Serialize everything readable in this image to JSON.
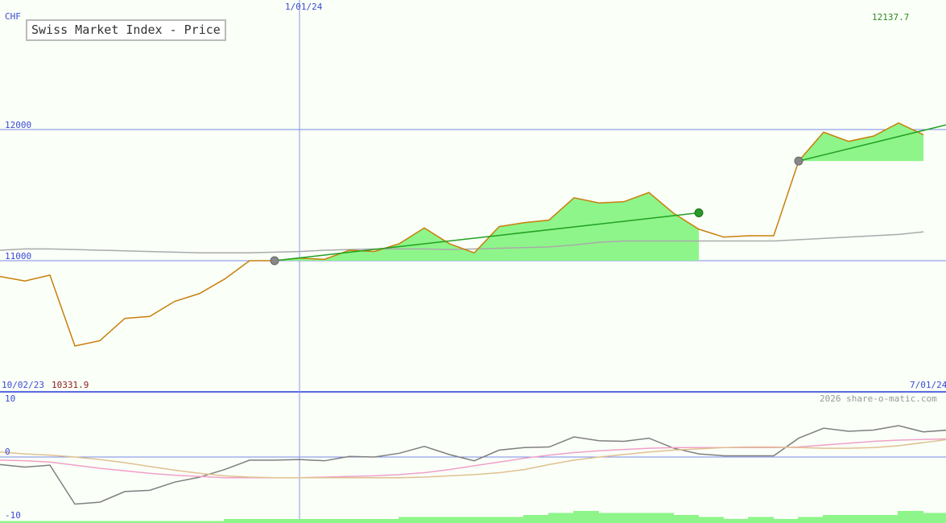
{
  "chart_data": [
    {
      "type": "line",
      "title": "Swiss Market Index - Price",
      "currency": "CHF",
      "ylim": [
        10270,
        12270
      ],
      "ytick_labels": [
        "12000",
        "11000"
      ],
      "ytick_values": [
        12000,
        11000
      ],
      "vline_label": "1/01/24",
      "vline_x": 12,
      "x_start_label": "10/02/23",
      "x_end_label": "7/01/24",
      "low_label": "10331.9",
      "high_label": "12137.7",
      "x_count": 38,
      "series": [
        {
          "name": "",
          "color": "#c87f0a",
          "values": [
            10880,
            10845,
            10890,
            10350,
            10390,
            10560,
            10575,
            10690,
            10750,
            10860,
            11000,
            11000,
            11020,
            11010,
            11080,
            11070,
            11130,
            11250,
            11130,
            11060,
            11260,
            11290,
            11310,
            11480,
            11440,
            11450,
            11520,
            11360,
            11240,
            11180,
            11190,
            11190,
            11760,
            11980,
            11910,
            11950,
            12050,
            11960
          ]
        },
        {
          "name": "",
          "color": "#aaaaaa",
          "values": [
            11080,
            11090,
            11090,
            11085,
            11080,
            11075,
            11070,
            11065,
            11060,
            11060,
            11060,
            11065,
            11070,
            11080,
            11085,
            11090,
            11090,
            11090,
            11085,
            11090,
            11095,
            11100,
            11105,
            11120,
            11140,
            11150,
            11150,
            11150,
            11150,
            11150,
            11150,
            11150,
            11160,
            11170,
            11180,
            11190,
            11200,
            11220
          ]
        }
      ],
      "trend_segments": [
        {
          "from": [
            11,
            11000
          ],
          "to": [
            28,
            11365
          ]
        },
        {
          "from": [
            32,
            11760
          ],
          "to": [
            38,
            12040
          ]
        }
      ]
    },
    {
      "type": "line",
      "title": "",
      "ylim": [
        -10,
        10
      ],
      "ytick_labels": [
        "10",
        "0",
        "-10"
      ],
      "ytick_values": [
        10,
        0,
        -10
      ],
      "watermark": "2026 share-o-matic.com",
      "series": [
        {
          "name": "",
          "color": "#7f7f7f",
          "values": [
            -1.2,
            -1.6,
            -1.3,
            -7.5,
            -7.2,
            -5.5,
            -5.3,
            -4.0,
            -3.2,
            -2.0,
            -0.5,
            -0.5,
            -0.4,
            -0.6,
            0.1,
            0.0,
            0.6,
            1.7,
            0.4,
            -0.6,
            1.1,
            1.5,
            1.6,
            3.2,
            2.6,
            2.5,
            3.0,
            1.4,
            0.5,
            0.2,
            0.2,
            0.2,
            3.0,
            4.6,
            4.1,
            4.3,
            5.0,
            4.0,
            4.3
          ]
        },
        {
          "name": "",
          "color": "#f0a0c8",
          "values": [
            -0.5,
            -0.6,
            -0.8,
            -1.3,
            -1.8,
            -2.2,
            -2.6,
            -2.9,
            -3.1,
            -3.3,
            -3.3,
            -3.3,
            -3.3,
            -3.2,
            -3.1,
            -3.0,
            -2.8,
            -2.5,
            -2.0,
            -1.4,
            -0.8,
            -0.2,
            0.3,
            0.7,
            1.0,
            1.2,
            1.4,
            1.5,
            1.5,
            1.5,
            1.5,
            1.5,
            1.6,
            1.9,
            2.2,
            2.5,
            2.7,
            2.8,
            2.9
          ]
        },
        {
          "name": "",
          "color": "#e0c090",
          "values": [
            0.8,
            0.5,
            0.3,
            0.0,
            -0.4,
            -0.9,
            -1.5,
            -2.1,
            -2.6,
            -3.0,
            -3.2,
            -3.3,
            -3.3,
            -3.3,
            -3.3,
            -3.3,
            -3.3,
            -3.2,
            -3.0,
            -2.8,
            -2.5,
            -2.0,
            -1.2,
            -0.5,
            0.0,
            0.4,
            0.8,
            1.1,
            1.3,
            1.5,
            1.6,
            1.6,
            1.5,
            1.4,
            1.4,
            1.5,
            1.8,
            2.3,
            2.8
          ]
        }
      ],
      "volume": [
        1,
        1,
        1,
        1,
        1,
        1,
        1,
        1,
        1,
        2,
        2,
        2,
        2,
        2,
        2,
        2,
        3,
        3,
        3,
        3,
        3,
        4,
        5,
        6,
        5,
        5,
        5,
        4,
        3,
        2,
        3,
        2,
        3,
        4,
        4,
        4,
        6,
        5,
        6
      ]
    }
  ]
}
